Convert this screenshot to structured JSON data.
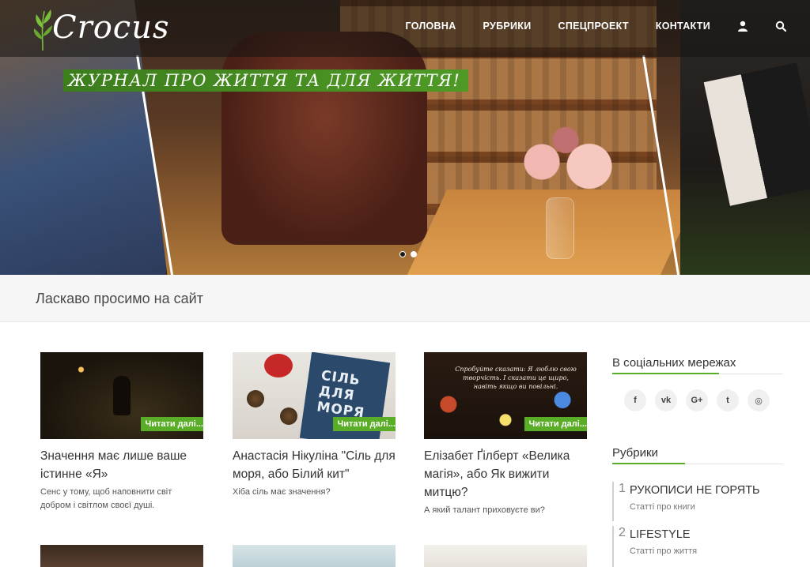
{
  "site": {
    "logo_text": "Crocus",
    "tagline": "ЖУРНАЛ ПРО ЖИТТЯ ТА ДЛЯ ЖИТТЯ!"
  },
  "nav": {
    "items": [
      {
        "label": "ГОЛОВНА"
      },
      {
        "label": "РУБРИКИ"
      },
      {
        "label": "СПЕЦПРОЕКТ"
      },
      {
        "label": "КОНТАКТИ"
      }
    ],
    "icons": [
      "user-icon",
      "search-icon"
    ]
  },
  "slider": {
    "slides": 2,
    "active": 2
  },
  "welcome": {
    "text": "Ласкаво просимо на сайт"
  },
  "posts": [
    {
      "title": "Значення має лише ваше істинне «Я»",
      "excerpt": "Сенс у тому, щоб наповнити світ добром і світлом своєї душі.",
      "read_more": "Читати далі..."
    },
    {
      "title": "Анастасія Нікуліна \"Сіль для моря, або Білий кит\"",
      "excerpt": "Хіба сіль має значення?",
      "read_more": "Читати далі...",
      "thumb_text": "СІЛЬ ДЛЯ МОРЯ"
    },
    {
      "title": "Елізабет Ґілберт «Велика магія», або Як вижити митцю?",
      "excerpt": "А який талант приховуєте ви?",
      "read_more": "Читати далі...",
      "thumb_text": "Спробуйте сказати: Я люблю свою творчість. І сказати це щиро, навіть якщо ви повільні."
    }
  ],
  "sidebar": {
    "social_heading": "В соціальних мережах",
    "social": [
      {
        "icon": "facebook-icon",
        "glyph": "f"
      },
      {
        "icon": "vk-icon",
        "glyph": "vk"
      },
      {
        "icon": "google-plus-icon",
        "glyph": "G+"
      },
      {
        "icon": "twitter-icon",
        "glyph": "t"
      },
      {
        "icon": "instagram-icon",
        "glyph": "◎"
      }
    ],
    "categories_heading": "Рубрики",
    "categories": [
      {
        "num": "1",
        "name": "РУКОПИСИ НЕ ГОРЯТЬ",
        "sub": "Статті про книги"
      },
      {
        "num": "2",
        "name": "LIFESTYLE",
        "sub": "Статті про життя"
      }
    ]
  },
  "colors": {
    "accent": "#5aad27",
    "tagline_bg": "#3c7d1c",
    "text": "#333333"
  }
}
